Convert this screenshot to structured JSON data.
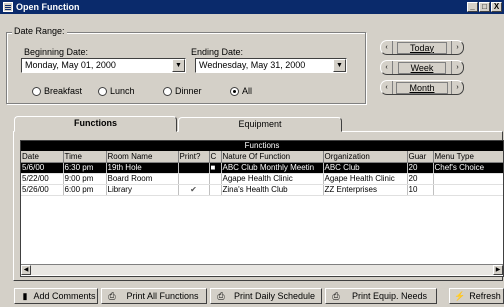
{
  "window": {
    "title": "Open Function",
    "controls": [
      "_",
      "□",
      "X"
    ]
  },
  "date_range": {
    "label": "Date Range:",
    "beginning_label": "Beginning Date:",
    "beginning_value": "Monday, May 01, 2000",
    "ending_label": "Ending Date:",
    "ending_value": "Wednesday, May 31, 2000",
    "meal_options": [
      {
        "label": "Breakfast",
        "selected": false
      },
      {
        "label": "Lunch",
        "selected": false
      },
      {
        "label": "Dinner",
        "selected": false
      },
      {
        "label": "All",
        "selected": true
      }
    ]
  },
  "nav": {
    "today": "Today",
    "week": "Week",
    "month": "Month",
    "left": "‹",
    "right": "›"
  },
  "tabs": [
    {
      "label": "Functions",
      "active": true
    },
    {
      "label": "Equipment",
      "active": false
    }
  ],
  "grid": {
    "title": "Functions",
    "columns": [
      "Date",
      "Time",
      "Room Name",
      "Print?",
      "C",
      "Nature Of Function",
      "Organization",
      "Guar",
      "Menu Type"
    ],
    "rows": [
      {
        "cells": [
          "5/6/00",
          "6:30 pm",
          "19th Hole",
          "",
          "■",
          "ABC Club Monthly Meetin",
          "ABC Club",
          "20",
          "Chef's Choice"
        ],
        "selected": true
      },
      {
        "cells": [
          "5/22/00",
          "9:00 pm",
          "Board Room",
          "",
          "",
          "Agape Health Clinic",
          "Agape Health Clinic",
          "20",
          ""
        ],
        "selected": false
      },
      {
        "cells": [
          "5/26/00",
          "6:00 pm",
          "Library",
          "✔",
          "",
          "Zina's Health Club",
          "ZZ Enterprises",
          "10",
          ""
        ],
        "selected": false
      }
    ]
  },
  "buttons": {
    "add_comments": "Add Comments",
    "print_all": "Print All Functions",
    "print_schedule": "Print Daily Schedule",
    "print_equip": "Print Equip. Needs",
    "refresh": "Refresh"
  }
}
